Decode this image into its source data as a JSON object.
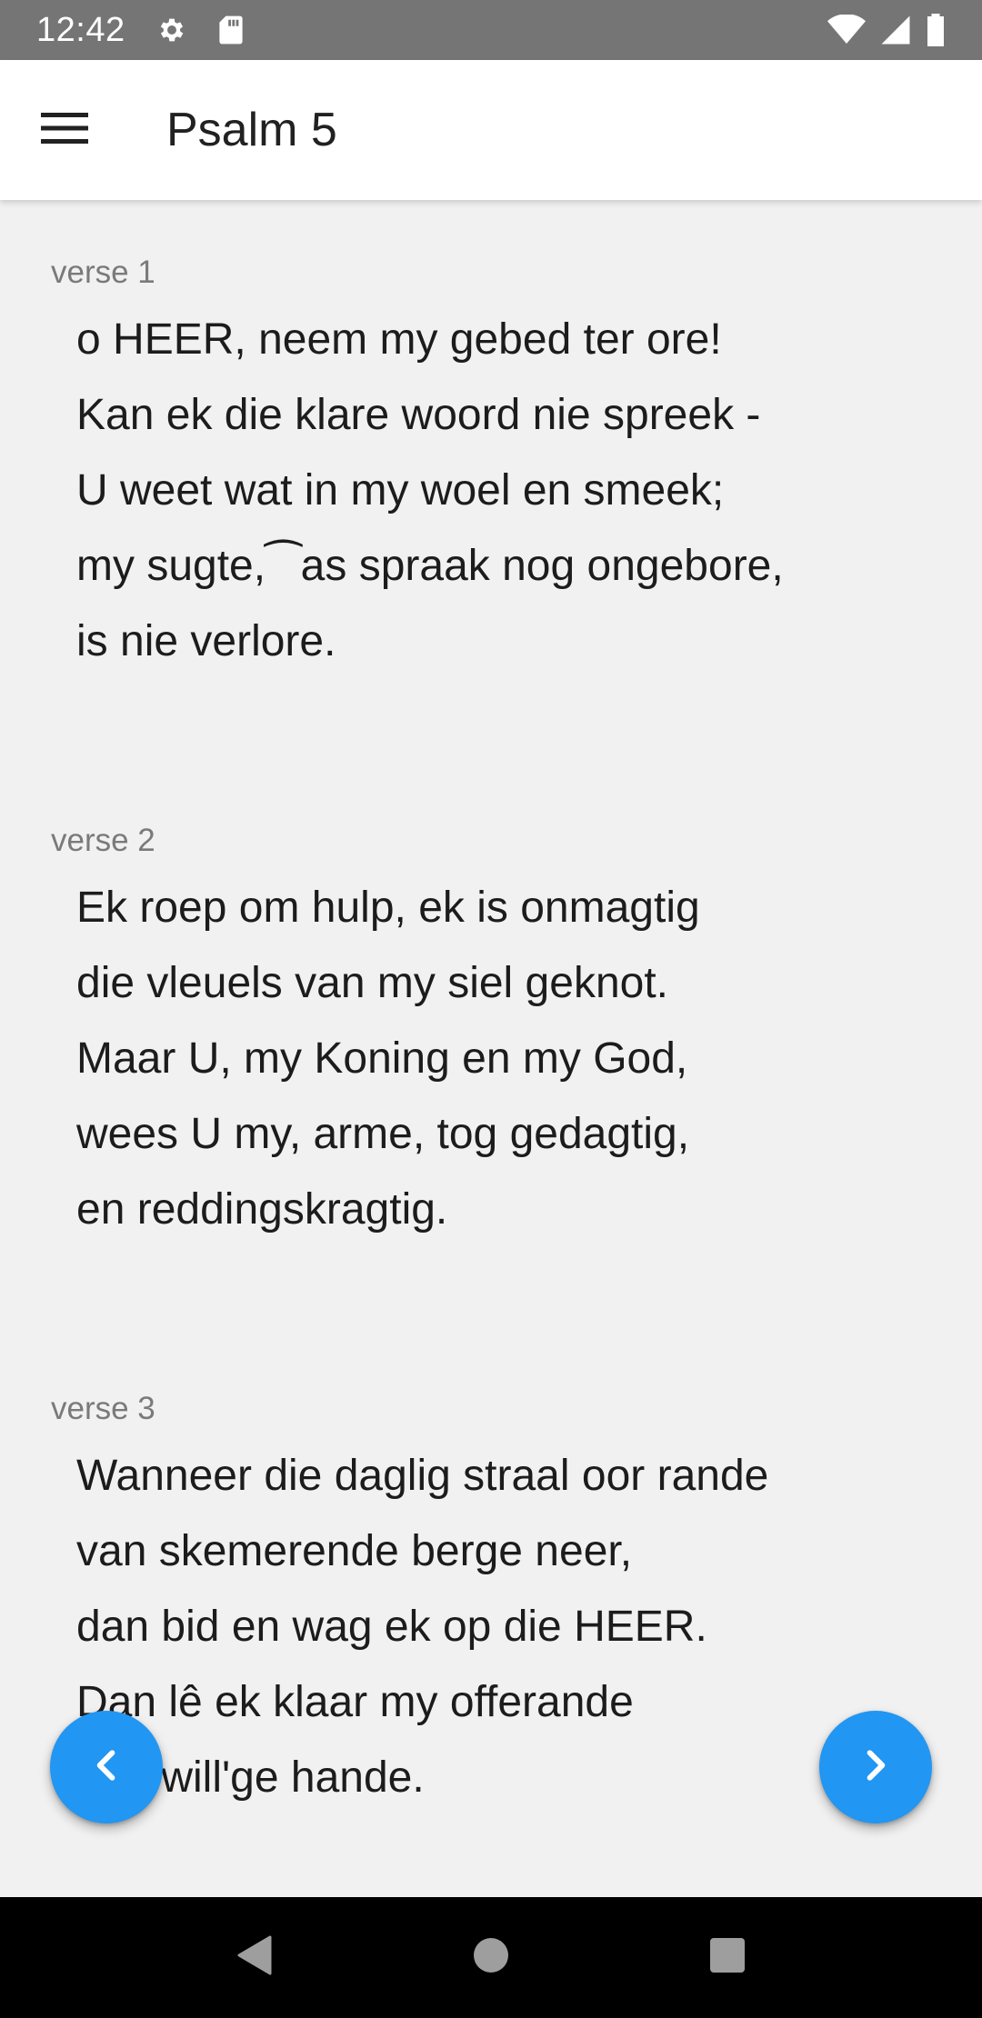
{
  "status_bar": {
    "time": "12:42",
    "icons_left": [
      "gear-icon",
      "sd-card-icon"
    ],
    "icons_right": [
      "wifi-icon",
      "cell-signal-icon",
      "battery-icon"
    ]
  },
  "app_bar": {
    "menu_icon": "hamburger-menu-icon",
    "title": "Psalm 5"
  },
  "verses": [
    {
      "label": "verse 1",
      "lines": [
        "o HEER, neem my gebed ter ore!",
        "Kan ek die klare woord nie spreek -",
        "U weet wat in my woel en smeek;",
        "my sugte,⁀as spraak nog ongebore,",
        "is nie verlore."
      ]
    },
    {
      "label": "verse 2",
      "lines": [
        "Ek roep om hulp, ek is onmagtig",
        "die vleuels van my siel geknot.",
        "Maar U, my Koning en my God,",
        "wees U my, arme, tog gedagtig,",
        "en reddingskragtig."
      ]
    },
    {
      "label": "verse 3",
      "lines": [
        "Wanneer die daglig straal oor rande",
        "van skemerende berge neer,",
        "dan bid en wag ek op die HEER.",
        "Dan lê ek klaar my offerande",
        "met will'ge hande."
      ]
    }
  ],
  "fabs": {
    "previous_icon": "chevron-left-icon",
    "next_icon": "chevron-right-icon",
    "color": "#2196f3"
  },
  "nav_bar": {
    "buttons": [
      "back-triangle-icon",
      "home-circle-icon",
      "recents-square-icon"
    ]
  },
  "colors": {
    "status_bar": "#757575",
    "app_bar": "#ffffff",
    "background": "#f1f1f1",
    "nav_bar": "#000000"
  }
}
